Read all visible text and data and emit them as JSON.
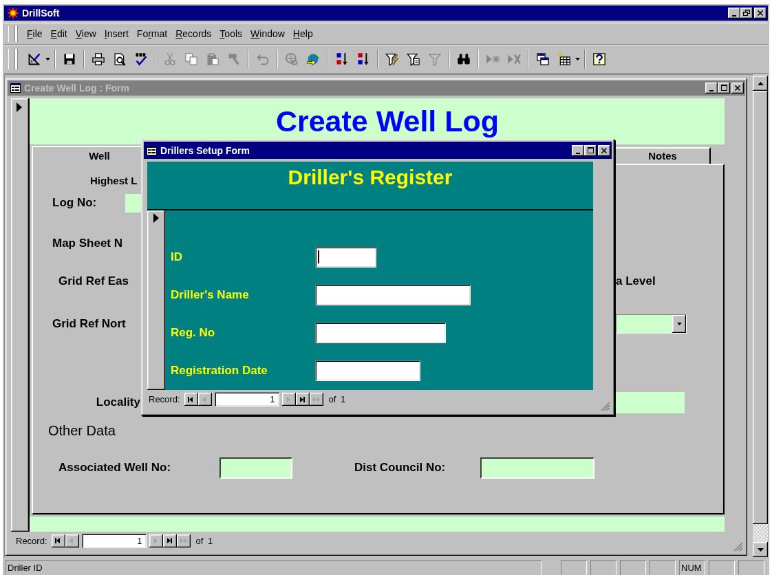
{
  "app": {
    "title": "DrillSoft",
    "active": true
  },
  "menu": [
    {
      "accel": "F",
      "rest": "ile"
    },
    {
      "accel": "E",
      "rest": "dit"
    },
    {
      "accel": "V",
      "rest": "iew"
    },
    {
      "accel": "I",
      "rest": "nsert"
    },
    {
      "lead": "Fo",
      "accel": "r",
      "rest": "mat"
    },
    {
      "accel": "R",
      "rest": "ecords"
    },
    {
      "accel": "T",
      "rest": "ools"
    },
    {
      "accel": "W",
      "rest": "indow"
    },
    {
      "accel": "H",
      "rest": "elp"
    }
  ],
  "toolbar": [
    {
      "items": [
        {
          "kind": "design",
          "disabled": false,
          "dropdown": true
        }
      ]
    },
    {
      "items": [
        {
          "kind": "save",
          "disabled": false,
          "dropdown": false
        }
      ]
    },
    {
      "items": [
        {
          "kind": "print",
          "disabled": false,
          "dropdown": false
        },
        {
          "kind": "preview",
          "disabled": false,
          "dropdown": false
        },
        {
          "kind": "spelling",
          "disabled": false,
          "dropdown": false
        }
      ]
    },
    {
      "items": [
        {
          "kind": "cut",
          "disabled": true,
          "dropdown": false
        },
        {
          "kind": "copy",
          "disabled": true,
          "dropdown": false
        },
        {
          "kind": "paste",
          "disabled": true,
          "dropdown": false
        },
        {
          "kind": "painter",
          "disabled": true,
          "dropdown": false
        }
      ]
    },
    {
      "items": [
        {
          "kind": "undo",
          "disabled": true,
          "dropdown": false
        }
      ]
    },
    {
      "items": [
        {
          "kind": "hyperlink",
          "disabled": true,
          "dropdown": false
        },
        {
          "kind": "web",
          "disabled": false,
          "dropdown": false
        }
      ]
    },
    {
      "items": [
        {
          "kind": "sort_asc",
          "disabled": false,
          "dropdown": false
        },
        {
          "kind": "sort_desc",
          "disabled": false,
          "dropdown": false
        }
      ]
    },
    {
      "items": [
        {
          "kind": "filter_selection",
          "disabled": false,
          "dropdown": false
        },
        {
          "kind": "filter_form",
          "disabled": false,
          "dropdown": false
        },
        {
          "kind": "apply_filter",
          "disabled": true,
          "dropdown": false
        }
      ]
    },
    {
      "items": [
        {
          "kind": "find",
          "disabled": false,
          "dropdown": false
        }
      ]
    },
    {
      "items": [
        {
          "kind": "new_record",
          "disabled": true,
          "dropdown": false
        },
        {
          "kind": "delete_record",
          "disabled": true,
          "dropdown": false
        }
      ]
    },
    {
      "items": [
        {
          "kind": "database_window",
          "disabled": false,
          "dropdown": false
        },
        {
          "kind": "new_object",
          "disabled": false,
          "dropdown": true
        }
      ]
    },
    {
      "items": [
        {
          "kind": "help",
          "disabled": false,
          "dropdown": false
        }
      ]
    }
  ],
  "form": {
    "title": "Create Well Log : Form",
    "active": false,
    "heading": "Create Well Log",
    "tabs": [
      {
        "label": "Well",
        "selected": true
      },
      {
        "label": "Notes",
        "selected": false
      }
    ],
    "rows": [
      {
        "label": "Highest L",
        "kind": "caption"
      },
      {
        "label": "Log No:",
        "kind": "field"
      },
      {
        "label": "Map Sheet N",
        "kind": "label"
      },
      {
        "label": "Grid Ref Eas",
        "kind": "label",
        "right": {
          "kind": "text",
          "label": "a Level"
        }
      },
      {
        "label": "Grid Ref Nort",
        "kind": "label",
        "right": {
          "kind": "combo"
        }
      },
      {
        "label": "Locality",
        "kind": "label",
        "right": {
          "kind": "field"
        }
      }
    ],
    "other_heading": "Other Data",
    "other_fields": [
      {
        "label": "Associated Well No:"
      },
      {
        "label": "Dist Council No:"
      }
    ],
    "nav": {
      "label": "Record:",
      "value": "1",
      "total": "of 1",
      "buttons": [
        {
          "kind": "first",
          "disabled": false
        },
        {
          "kind": "prev",
          "disabled": true
        },
        {
          "kind": "next",
          "disabled": true
        },
        {
          "kind": "last",
          "disabled": false
        },
        {
          "kind": "new",
          "disabled": true
        }
      ]
    }
  },
  "dialog": {
    "title": "Drillers Setup Form",
    "active": true,
    "heading": "Driller's Register",
    "fields": [
      {
        "label": "ID",
        "focused": true
      },
      {
        "label": "Driller's Name",
        "focused": false
      },
      {
        "label": "Reg. No",
        "focused": false
      },
      {
        "label": "Registration Date",
        "focused": false
      }
    ],
    "nav": {
      "label": "Record:",
      "value": "1",
      "total": "of 1",
      "buttons": [
        {
          "kind": "first",
          "disabled": false
        },
        {
          "kind": "prev",
          "disabled": true
        },
        {
          "kind": "next",
          "disabled": true
        },
        {
          "kind": "last",
          "disabled": false
        },
        {
          "kind": "new",
          "disabled": true
        }
      ]
    }
  },
  "status_bar": {
    "text": "Driller ID",
    "indicators": [
      {
        "label": "NUM"
      }
    ]
  }
}
